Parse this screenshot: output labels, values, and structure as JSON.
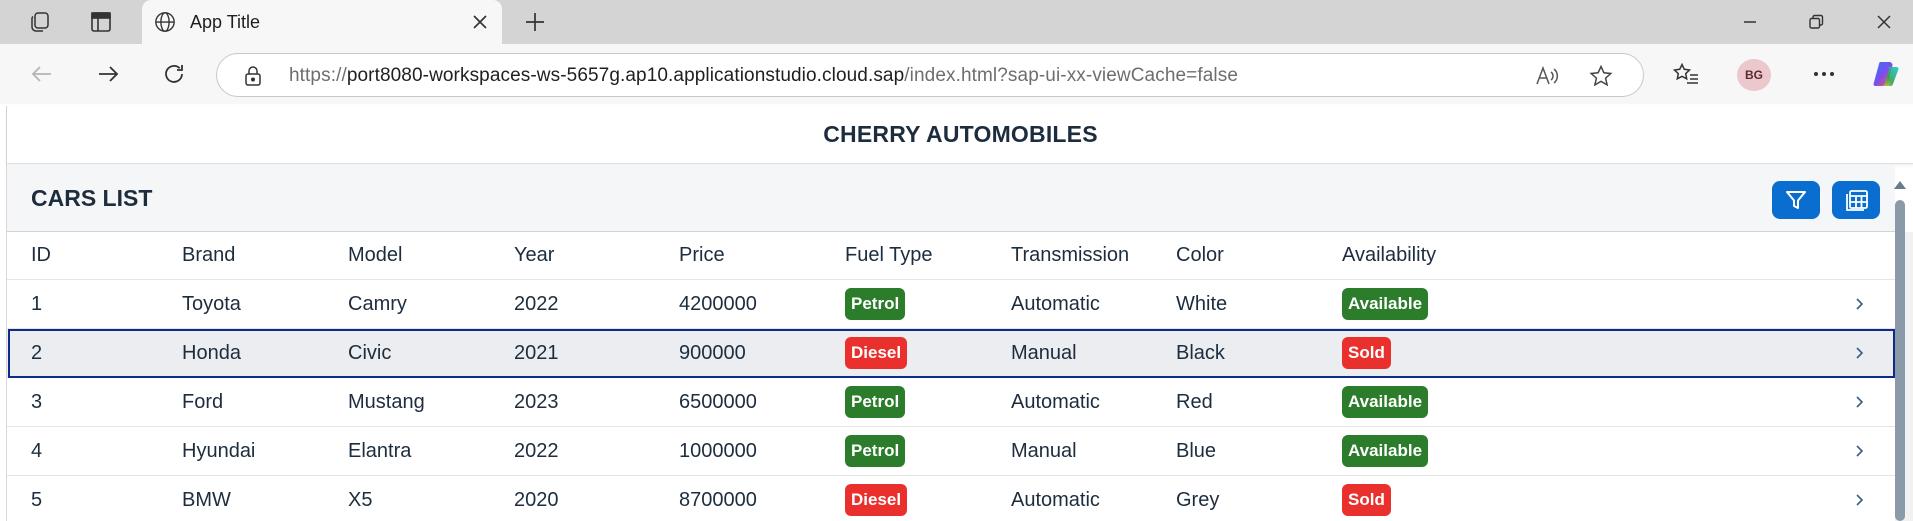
{
  "browser": {
    "tab_title": "App Title",
    "url_proto": "https://",
    "url_host": "port8080-workspaces-ws-5657g.ap10.applicationstudio.cloud.sap",
    "url_path": "/index.html?sap-ui-xx-viewCache=false",
    "profile_initials": "BG"
  },
  "app": {
    "title": "CHERRY AUTOMOBILES",
    "list_title": "CARS LIST"
  },
  "table": {
    "columns": [
      "ID",
      "Brand",
      "Model",
      "Year",
      "Price",
      "Fuel Type",
      "Transmission",
      "Color",
      "Availability"
    ],
    "rows": [
      {
        "id": "1",
        "brand": "Toyota",
        "model": "Camry",
        "year": "2022",
        "price": "4200000",
        "fuel": "Petrol",
        "transmission": "Automatic",
        "color": "White",
        "availability": "Available"
      },
      {
        "id": "2",
        "brand": "Honda",
        "model": "Civic",
        "year": "2021",
        "price": "900000",
        "fuel": "Diesel",
        "transmission": "Manual",
        "color": "Black",
        "availability": "Sold"
      },
      {
        "id": "3",
        "brand": "Ford",
        "model": "Mustang",
        "year": "2023",
        "price": "6500000",
        "fuel": "Petrol",
        "transmission": "Automatic",
        "color": "Red",
        "availability": "Available"
      },
      {
        "id": "4",
        "brand": "Hyundai",
        "model": "Elantra",
        "year": "2022",
        "price": "1000000",
        "fuel": "Petrol",
        "transmission": "Manual",
        "color": "Blue",
        "availability": "Available"
      },
      {
        "id": "5",
        "brand": "BMW",
        "model": "X5",
        "year": "2020",
        "price": "8700000",
        "fuel": "Diesel",
        "transmission": "Automatic",
        "color": "Grey",
        "availability": "Sold"
      }
    ]
  },
  "colors": {
    "positive": "#2b7d2b",
    "negative": "#e9302c",
    "accent": "#0a6ed1",
    "selection_border": "#0d2b8a"
  }
}
